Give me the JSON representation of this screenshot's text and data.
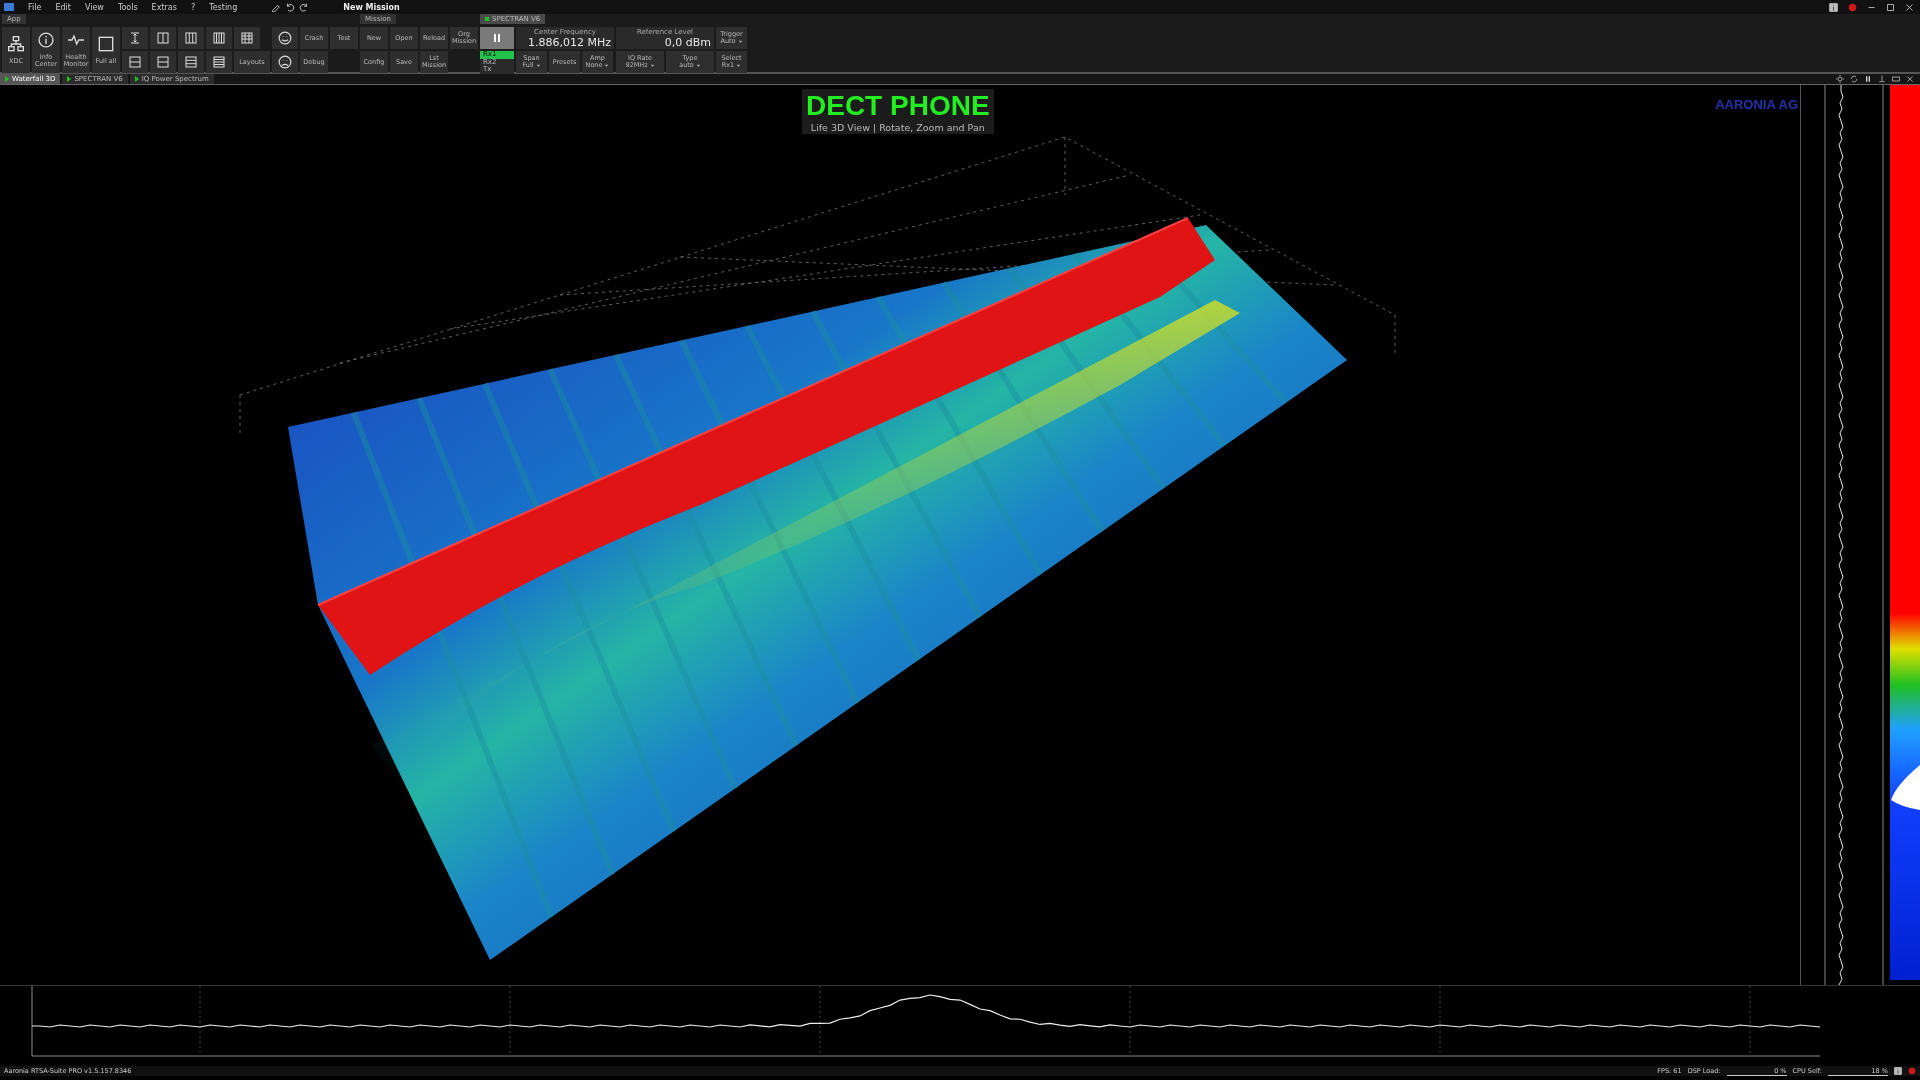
{
  "menu": [
    "File",
    "Edit",
    "View",
    "Tools",
    "Extras",
    "?",
    "Testing"
  ],
  "mission_title": "New Mission",
  "app_group": {
    "tab": "App",
    "selected": false,
    "big_buttons": [
      {
        "label": "XDC"
      },
      {
        "label": "Info Center"
      },
      {
        "label": "Health Monitor"
      },
      {
        "label": "Full all"
      }
    ],
    "layouts_button": "Layouts",
    "text_buttons": [
      [
        "Crash",
        "Debug"
      ],
      [
        "Test"
      ]
    ]
  },
  "mission_group": {
    "tab": "Mission",
    "selected": false,
    "buttons": [
      [
        "New",
        "Config"
      ],
      [
        "Open",
        "Save"
      ],
      [
        "Reload",
        "Lst Mission"
      ],
      [
        "Org Mission"
      ]
    ]
  },
  "device_group": {
    "tab": "SPECTRAN V6",
    "selected": true,
    "center_frequency": {
      "label": "Center Frequency",
      "value": "1.886,012 MHz"
    },
    "reference_level": {
      "label": "Reference Level",
      "value": "0,0 dBm"
    },
    "trigger": {
      "label": "Trigger",
      "value": "Auto"
    },
    "ports": [
      {
        "label": "Rx1",
        "selected": true
      },
      {
        "label": "Rx2",
        "selected": false
      },
      {
        "label": "Tx",
        "selected": false
      }
    ],
    "controls": [
      {
        "label": "Span",
        "value": "Full"
      },
      {
        "label": "Presets"
      },
      {
        "label": "Amp",
        "value": "None"
      },
      {
        "label": "IQ Rate",
        "value": "92MHz"
      },
      {
        "label": "Type",
        "value": "auto"
      },
      {
        "label": "Select",
        "value": "Rx1"
      }
    ]
  },
  "view_tabs": [
    {
      "label": "Waterfall 3D",
      "selected": true
    },
    {
      "label": "SPECTRAN V6",
      "selected": false
    },
    {
      "label": "IQ Power Spectrum",
      "selected": false
    }
  ],
  "view_title": {
    "heading": "DECT PHONE",
    "subtitle": "Life 3D View | Rotate, Zoom and Pan"
  },
  "logo": "AARONIA AG",
  "status_bar": {
    "version": "Aaronia RTSA-Suite PRO v1.5.157.8346",
    "fps": "FPS: 61",
    "dsp_label": "DSP Load:",
    "dsp_value": "0 %",
    "cpu_label": "CPU Self:",
    "cpu_value": "18 %"
  }
}
